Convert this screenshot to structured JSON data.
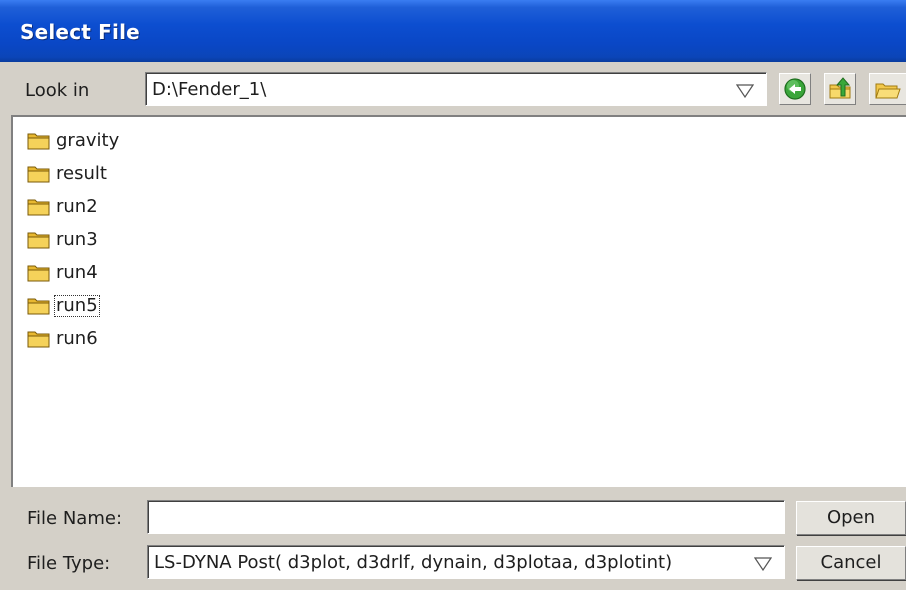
{
  "window": {
    "title": "Select File"
  },
  "look_in": {
    "label": "Look in",
    "path": "D:\\Fender_1\\",
    "dropdown_icon": "dropdown-triangle-icon"
  },
  "toolbar": {
    "back_icon": "back-arrow-icon",
    "up_icon": "up-folder-icon",
    "new_folder_icon": "new-folder-icon"
  },
  "file_list": {
    "items": [
      {
        "name": "gravity",
        "icon": "folder-icon"
      },
      {
        "name": "result",
        "icon": "folder-icon"
      },
      {
        "name": "run2",
        "icon": "folder-icon"
      },
      {
        "name": "run3",
        "icon": "folder-icon"
      },
      {
        "name": "run4",
        "icon": "folder-icon"
      },
      {
        "name": "run5",
        "icon": "folder-icon",
        "focused": true
      },
      {
        "name": "run6",
        "icon": "folder-icon"
      }
    ]
  },
  "file_name": {
    "label": "File Name:",
    "value": ""
  },
  "file_type": {
    "label": "File Type:",
    "value": "LS-DYNA Post( d3plot, d3drlf, dynain, d3plotaa, d3plotint)"
  },
  "buttons": {
    "open": "Open",
    "cancel": "Cancel"
  },
  "colors": {
    "titlebar": "#0a47c6",
    "dialog_bg": "#d4d0c8",
    "folder_yellow": "#f5d25a"
  }
}
